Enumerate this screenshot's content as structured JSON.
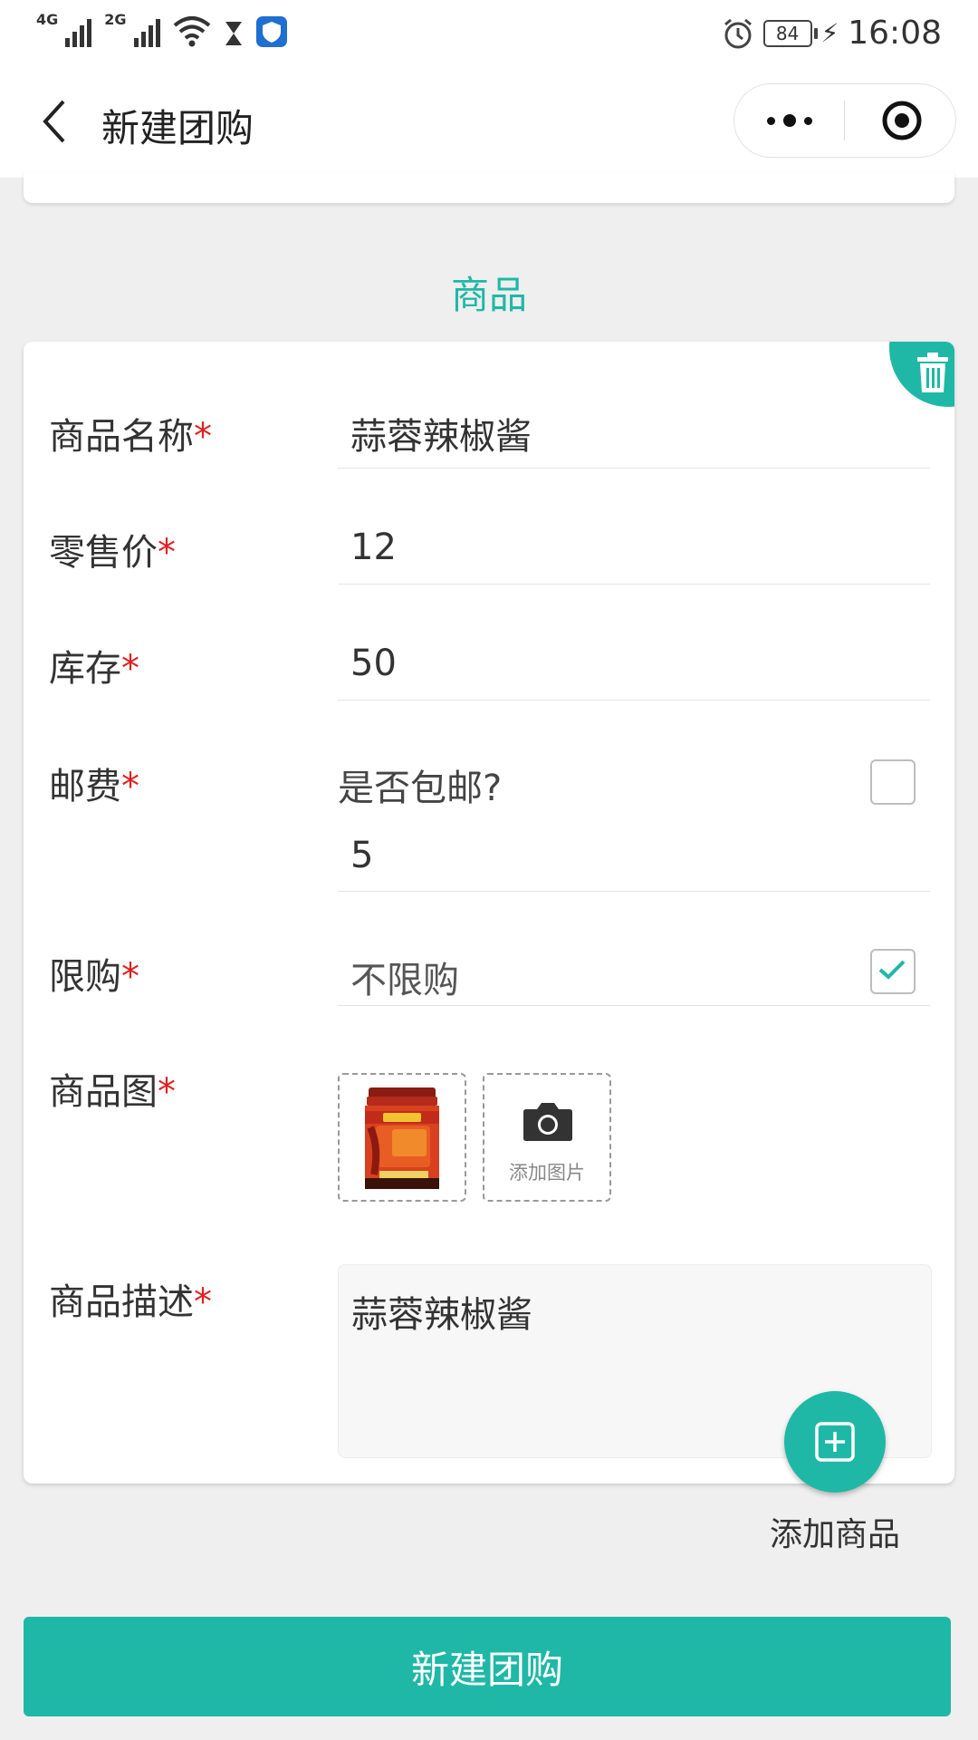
{
  "status_bar": {
    "sim1": "4G",
    "sim2": "2G",
    "battery": "84",
    "time": "16:08"
  },
  "nav": {
    "title": "新建团购"
  },
  "section": {
    "title": "商品"
  },
  "form": {
    "name": {
      "label": "商品名称",
      "value": "蒜蓉辣椒酱"
    },
    "price": {
      "label": "零售价",
      "value": "12"
    },
    "stock": {
      "label": "库存",
      "value": "50"
    },
    "shipping": {
      "label": "邮费",
      "free_question": "是否包邮?",
      "free_checked": false,
      "value": "5"
    },
    "limit": {
      "label": "限购",
      "value": "不限购",
      "checked": true
    },
    "images": {
      "label": "商品图",
      "add_label": "添加图片"
    },
    "description": {
      "label": "商品描述",
      "value": "蒜蓉辣椒酱"
    },
    "required_mark": "*"
  },
  "add_product": {
    "label": "添加商品"
  },
  "submit": {
    "label": "新建团购"
  },
  "colors": {
    "accent": "#1fb8a6",
    "required": "#e02020"
  }
}
